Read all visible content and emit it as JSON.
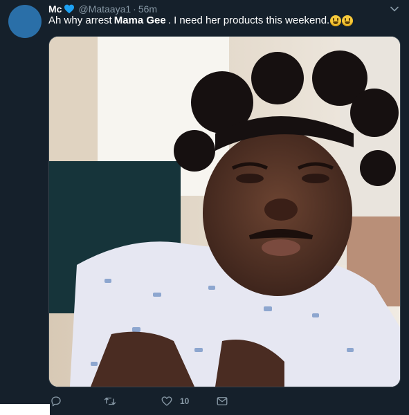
{
  "tweet": {
    "display_name": "Mc",
    "handle": "@Mataaya1",
    "separator": "·",
    "time": "56m",
    "text_before": "Ah why arrest",
    "text_bold": "Mama Gee",
    "text_after": ". I need her products this weekend.",
    "emoji": [
      "grinning-face",
      "grinning-face"
    ]
  },
  "actions": {
    "reply_count": "",
    "retweet_count": "",
    "like_count": "10"
  },
  "colors": {
    "background": "#15202b",
    "muted": "#8899a6",
    "verified_heart": "#1da1f2"
  },
  "icons": [
    "caret-down-icon",
    "blue-heart-icon",
    "reply-icon",
    "retweet-icon",
    "like-icon",
    "message-icon"
  ]
}
